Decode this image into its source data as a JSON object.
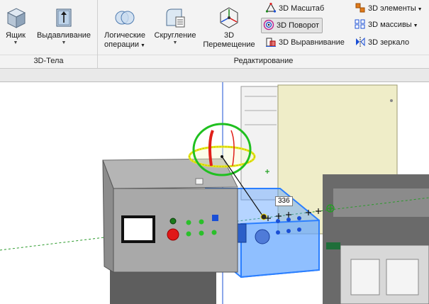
{
  "ribbon": {
    "groups": {
      "bodies": {
        "label": "3D-Тела"
      },
      "edit": {
        "label": "Редактирование"
      }
    },
    "buttons": {
      "box": {
        "label": "Ящик",
        "icon": "box-icon"
      },
      "extrude": {
        "label": "Выдавливание",
        "icon": "extrude-icon"
      },
      "boolean": {
        "label_line1": "Логические",
        "label_line2": "операции",
        "icon": "boolean-icon"
      },
      "fillet": {
        "label": "Скругление",
        "icon": "fillet-icon"
      },
      "move3d": {
        "label_line1": "3D",
        "label_line2": "Перемещение",
        "icon": "move3d-icon"
      },
      "scale3d": {
        "label": "3D Масштаб",
        "icon": "scale3d-icon"
      },
      "rotate3d": {
        "label": "3D Поворот",
        "icon": "rotate3d-icon",
        "active": true
      },
      "align3d": {
        "label": "3D Выравнивание",
        "icon": "align3d-icon"
      },
      "elements3d": {
        "label": "3D элементы",
        "icon": "elements3d-icon"
      },
      "arrays3d": {
        "label": "3D массивы",
        "icon": "arrays3d-icon"
      },
      "mirror3d": {
        "label": "3D зеркало",
        "icon": "mirror3d-icon"
      }
    }
  },
  "viewport": {
    "dimension_value": "336",
    "colors": {
      "selection": "#2b7fff",
      "gizmo_red": "#e0201a",
      "gizmo_green": "#20c020",
      "gizmo_yellow": "#e8e81a",
      "axis_dashed": "#2a9a2a",
      "panel_grey": "#8e8e8e"
    }
  }
}
